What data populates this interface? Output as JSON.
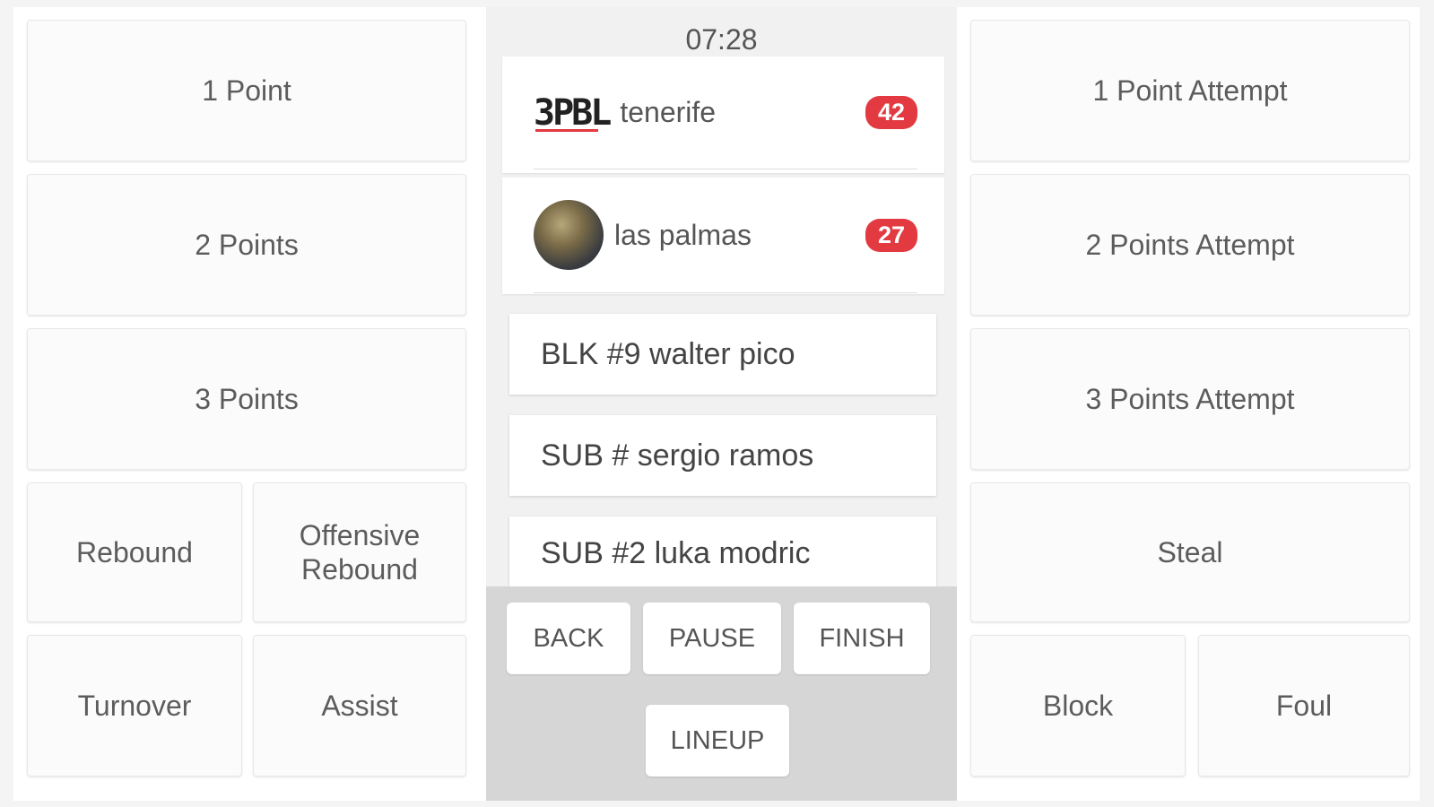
{
  "clock": "07:28",
  "left_buttons": {
    "one_point": "1 Point",
    "two_points": "2 Points",
    "three_points": "3 Points",
    "rebound": "Rebound",
    "offensive_rebound": "Offensive\nRebound",
    "turnover": "Turnover",
    "assist": "Assist"
  },
  "right_buttons": {
    "one_point_attempt": "1 Point Attempt",
    "two_points_attempt": "2 Points Attempt",
    "three_points_attempt": "3 Points Attempt",
    "steal": "Steal",
    "block": "Block",
    "foul": "Foul"
  },
  "teams": [
    {
      "logo_text": "3PBL",
      "name": "tenerife",
      "score": "42",
      "icon": "team-logo-3pbl"
    },
    {
      "name": "las palmas",
      "score": "27",
      "icon": "team-avatar"
    }
  ],
  "events": [
    "BLK #9 walter pico",
    "SUB # sergio ramos",
    "SUB #2 luka modric"
  ],
  "controls": {
    "back": "BACK",
    "pause": "PAUSE",
    "finish": "FINISH",
    "lineup": "LINEUP"
  },
  "colors": {
    "score_badge": "#e23a40",
    "panel_bg": "#ffffff",
    "center_bg": "#f1f1f1",
    "controls_bg": "#d6d6d6"
  }
}
